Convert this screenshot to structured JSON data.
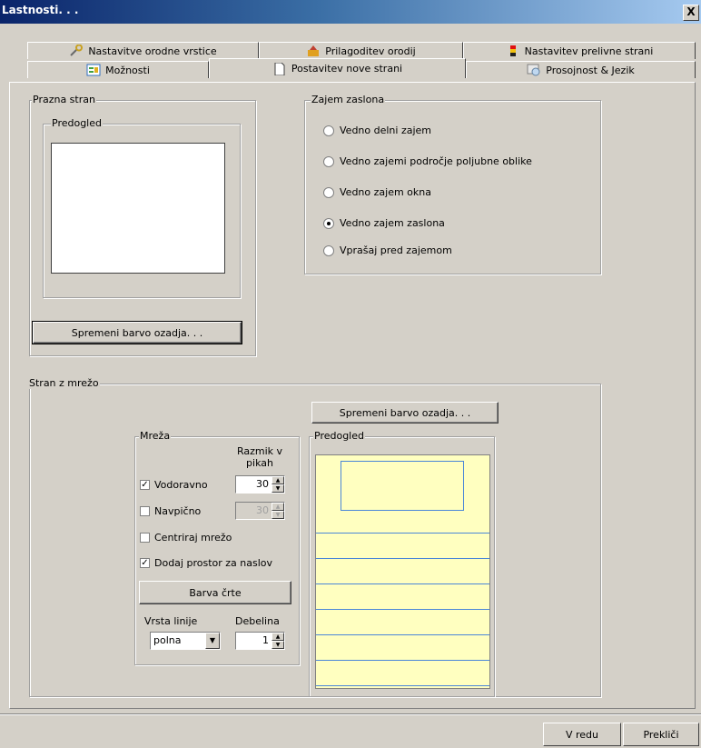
{
  "window": {
    "title": "Lastnosti. . .",
    "close": "X"
  },
  "tabs_row1": [
    {
      "label": "Nastavitve orodne vrstice",
      "icon": "wrench-icon"
    },
    {
      "label": "Prilagoditev orodij",
      "icon": "tools-icon"
    },
    {
      "label": "Nastavitev prelivne strani",
      "icon": "gradient-icon"
    }
  ],
  "tabs_row2": [
    {
      "label": "Možnosti",
      "icon": "options-icon"
    },
    {
      "label": "Postavitev nove strani",
      "icon": "page-icon"
    },
    {
      "label": "Prosojnost & Jezik",
      "icon": "transparency-icon"
    }
  ],
  "blank_page": {
    "legend": "Prazna stran",
    "preview_legend": "Predogled",
    "change_bg_button": "Spremeni barvo ozadja. . ."
  },
  "capture": {
    "legend": "Zajem zaslona",
    "options": [
      {
        "label": "Vedno delni zajem",
        "selected": false
      },
      {
        "label": "Vedno zajemi področje poljubne oblike",
        "selected": false
      },
      {
        "label": "Vedno zajem okna",
        "selected": false
      },
      {
        "label": "Vedno zajem zaslona",
        "selected": true
      },
      {
        "label": "Vprašaj pred zajemom",
        "selected": false
      }
    ]
  },
  "grid_page": {
    "legend": "Stran z mrežo",
    "change_bg_button": "Spremeni barvo ozadja. . .",
    "grid": {
      "legend": "Mreža",
      "spacing_label": "Razmik v pikah",
      "horizontal": {
        "label": "Vodoravno",
        "checked": true,
        "value": "30"
      },
      "vertical": {
        "label": "Navpično",
        "checked": false,
        "value": "30"
      },
      "center": {
        "label": "Centriraj mrežo",
        "checked": false
      },
      "title_space": {
        "label": "Dodaj prostor za naslov",
        "checked": true
      },
      "line_color_button": "Barva črte",
      "line_type_label": "Vrsta linije",
      "line_type_value": "polna",
      "thickness_label": "Debelina",
      "thickness_value": "1"
    },
    "preview_legend": "Predogled",
    "preview_bg": "#ffffc0",
    "line_color": "#4a86d8"
  },
  "buttons": {
    "ok": "V redu",
    "cancel": "Prekliči"
  }
}
